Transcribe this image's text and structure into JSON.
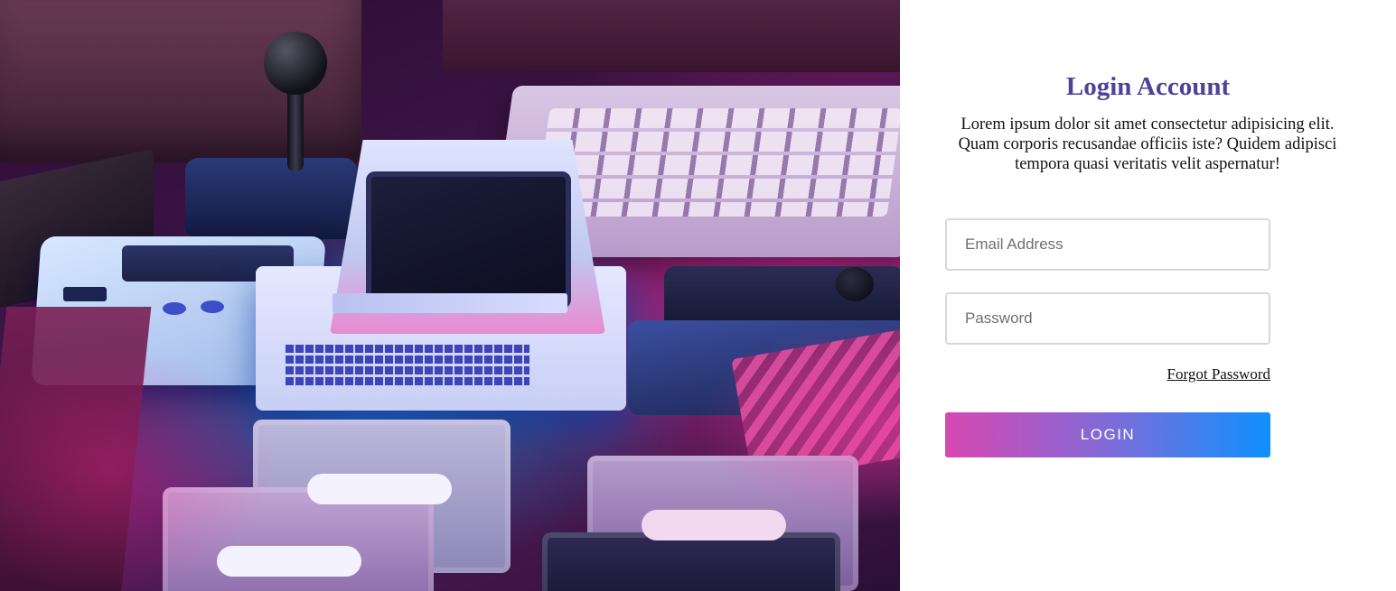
{
  "hero": {
    "image_semantic": "retro-computing-photo",
    "accent_colors": [
      "#00aaff",
      "#ff28a0"
    ]
  },
  "login": {
    "title": "Login Account",
    "description": "Lorem ipsum dolor sit amet consectetur adipisicing elit. Quam corporis recusandae officiis iste? Quidem adipisci tempora quasi veritatis velit aspernatur!",
    "email_placeholder": "Email Address",
    "email_value": "",
    "password_placeholder": "Password",
    "password_value": "",
    "forgot_label": "Forgot Password",
    "submit_label": "LOGIN",
    "title_color": "#4b449a",
    "button_gradient": [
      "#d848b2",
      "#8a67d4",
      "#0f90ff"
    ]
  }
}
